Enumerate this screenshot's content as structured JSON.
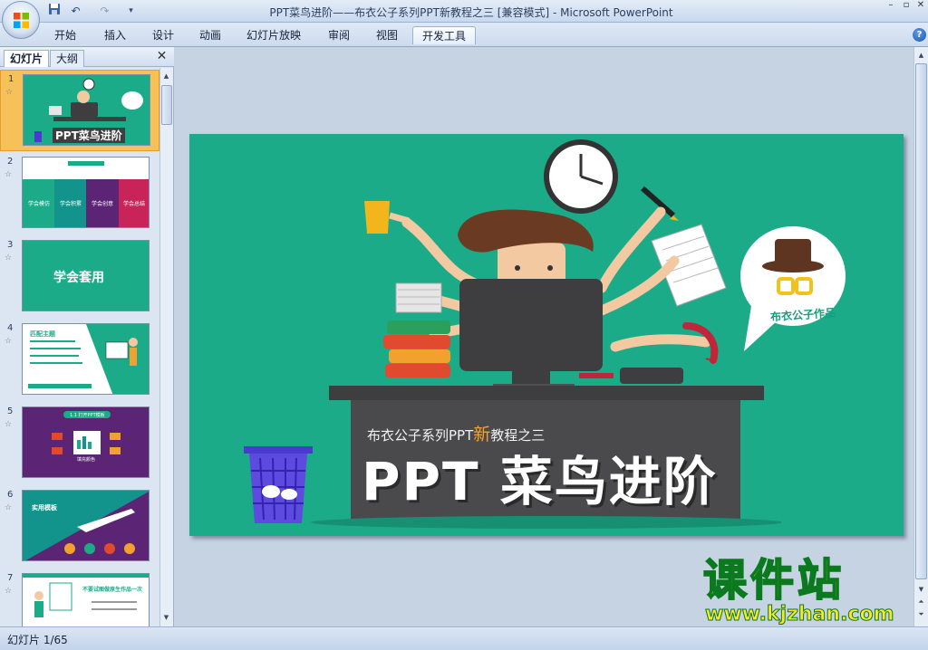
{
  "app": {
    "title": "PPT菜鸟进阶——布衣公子系列PPT新教程之三 [兼容模式] - Microsoft PowerPoint",
    "accent": "#1bab89",
    "selection": "#f7c15a"
  },
  "quick_access": [
    "save-icon",
    "undo-icon",
    "redo-icon",
    "customize-icon"
  ],
  "ribbon": {
    "tabs": [
      {
        "label": "开始"
      },
      {
        "label": "插入"
      },
      {
        "label": "设计"
      },
      {
        "label": "动画"
      },
      {
        "label": "幻灯片放映"
      },
      {
        "label": "审阅"
      },
      {
        "label": "视图"
      },
      {
        "label": "开发工具"
      }
    ],
    "active_tab": "开发工具"
  },
  "left_pane": {
    "tabs": [
      {
        "label": "幻灯片"
      },
      {
        "label": "大纲"
      }
    ],
    "thumbnails": [
      {
        "number": "1",
        "selected": true,
        "title": "PPT菜鸟进阶"
      },
      {
        "number": "2",
        "labels": [
          "学会模仿",
          "学会积累",
          "学会创意",
          "学会总结"
        ]
      },
      {
        "number": "3",
        "title": "学会套用"
      },
      {
        "number": "4",
        "title": "匹配主题"
      },
      {
        "number": "5",
        "title": "1.1 打开PPT模板",
        "center": "填充颜色"
      },
      {
        "number": "6",
        "title": "实用模板"
      },
      {
        "number": "7",
        "title": "不要试图做原生作品一次"
      }
    ]
  },
  "slide": {
    "subtitle_pre": "布衣公子系列PPT",
    "subtitle_highlight": "新",
    "subtitle_post": "教程之三",
    "title": "PPT 菜鸟进阶",
    "badge": "布衣公子作品"
  },
  "status": {
    "slide_indicator": "幻灯片 1/65"
  },
  "watermark": {
    "main": "课件站",
    "url": "www.kjzhan.com"
  }
}
